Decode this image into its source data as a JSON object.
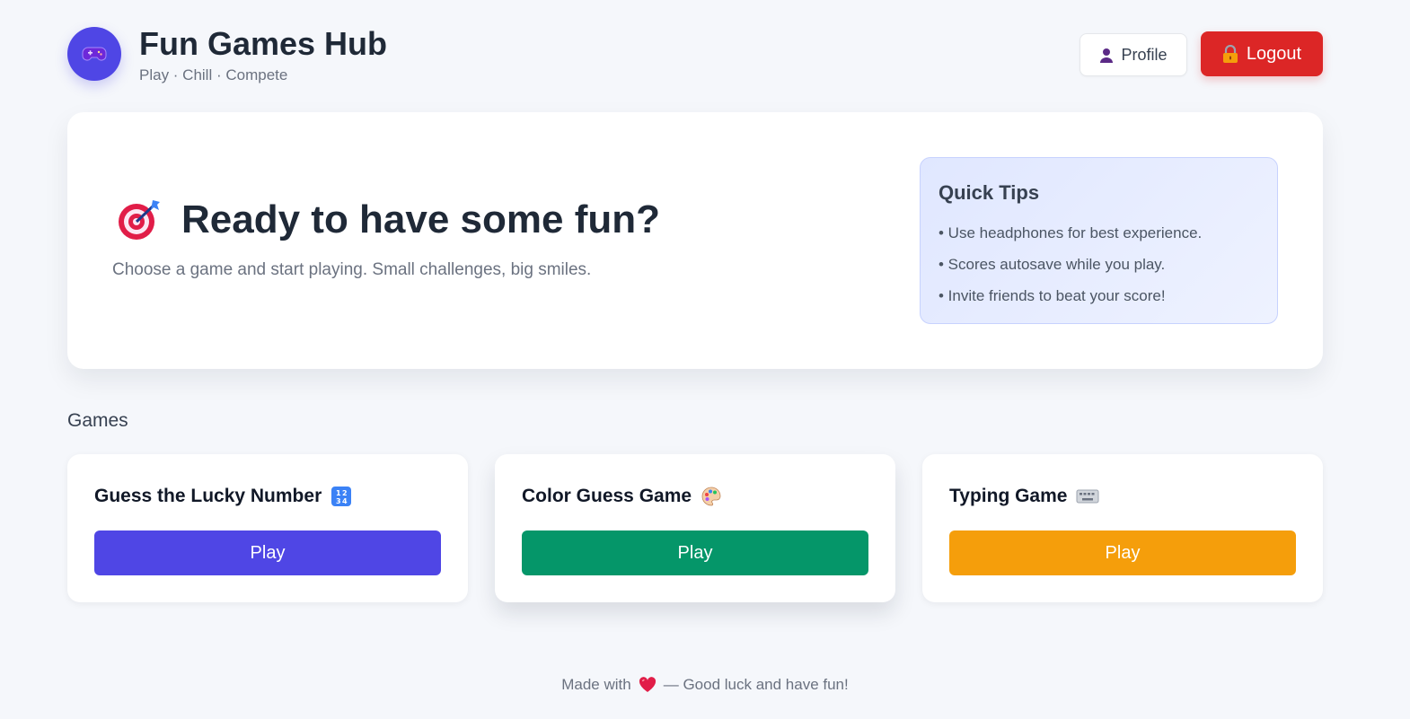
{
  "brand": {
    "title": "Fun Games Hub",
    "subtitle": "Play · Chill · Compete",
    "logo_icon": "gamepad-icon",
    "logo_color": "#4f46e5"
  },
  "header": {
    "profile_label": "Profile",
    "profile_icon": "user-icon",
    "logout_label": "Logout",
    "logout_icon": "lock-icon",
    "logout_color": "#dc2626"
  },
  "hero": {
    "icon": "dart-target-icon",
    "title": "Ready to have some fun?",
    "subtitle": "Choose a game and start playing. Small challenges, big smiles."
  },
  "tips": {
    "title": "Quick Tips",
    "items": [
      "• Use headphones for best experience.",
      "• Scores autosave while you play.",
      "• Invite friends to beat your score!"
    ]
  },
  "games": {
    "section_title": "Games",
    "items": [
      {
        "title": "Guess the Lucky Number",
        "icon": "number-keypad-icon",
        "play_label": "Play",
        "color": "#4f46e5"
      },
      {
        "title": "Color Guess Game",
        "icon": "palette-icon",
        "play_label": "Play",
        "color": "#059669"
      },
      {
        "title": "Typing Game",
        "icon": "keyboard-icon",
        "play_label": "Play",
        "color": "#f59e0b"
      }
    ]
  },
  "footer": {
    "before": "Made with",
    "heart_icon": "heart-icon",
    "after": "— Good luck and have fun!"
  }
}
